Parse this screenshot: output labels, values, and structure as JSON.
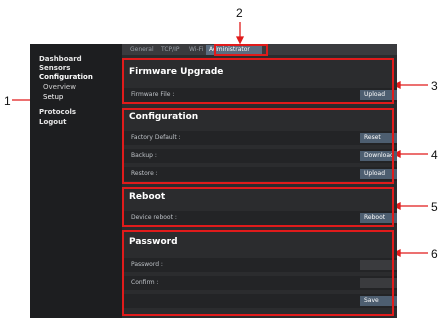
{
  "annotations": [
    "1",
    "2",
    "3",
    "4",
    "5",
    "6"
  ],
  "sidebar": {
    "items": [
      {
        "label": "Dashboard"
      },
      {
        "label": "Sensors"
      },
      {
        "label": "Configuration"
      },
      {
        "label": "Overview"
      },
      {
        "label": "Setup"
      },
      {
        "label": "Protocols"
      },
      {
        "label": "Logout"
      }
    ]
  },
  "tabs": [
    {
      "label": "General"
    },
    {
      "label": "TCP/IP"
    },
    {
      "label": "Wi-Fi"
    },
    {
      "label": "Administrator"
    }
  ],
  "firmware": {
    "title": "Firmware Upgrade",
    "file_label": "Firmware File :",
    "upload_label": "Upload"
  },
  "configuration": {
    "title": "Configuration",
    "factory_label": "Factory Default :",
    "reset_label": "Reset",
    "backup_label": "Backup :",
    "download_label": "Download",
    "restore_label": "Restore :",
    "upload_label": "Upload"
  },
  "reboot": {
    "title": "Reboot",
    "device_label": "Device reboot :",
    "reboot_label": "Reboot"
  },
  "password": {
    "title": "Password",
    "password_label": "Password :",
    "confirm_label": "Confirm :",
    "save_label": "Save"
  },
  "colors": {
    "annotation": "#e01b1b",
    "button": "#4d5e70",
    "active_tab": "#5b6d80"
  }
}
